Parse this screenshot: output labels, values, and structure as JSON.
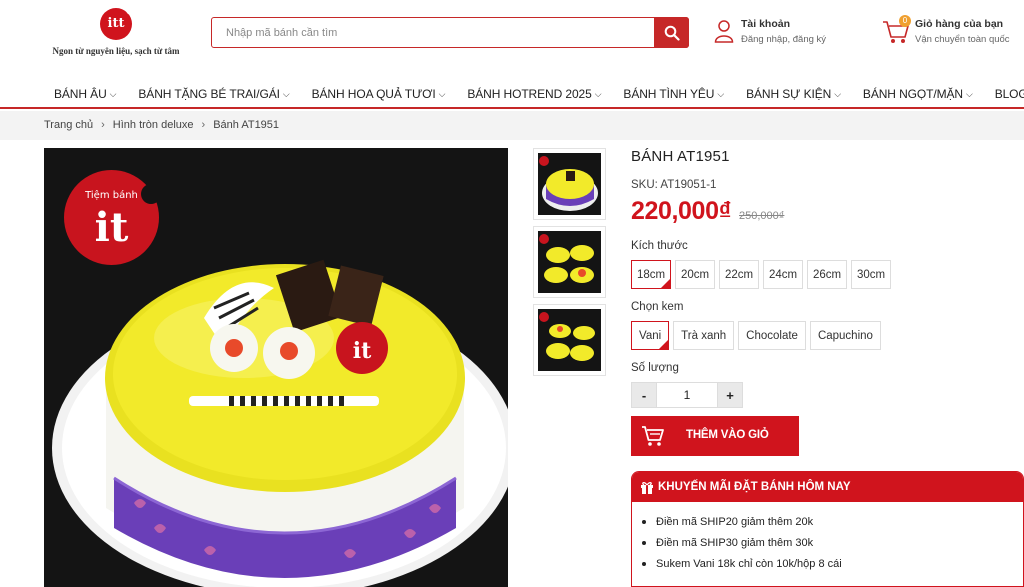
{
  "header": {
    "logo_text": "itt",
    "slogan": "Ngon từ nguyên liệu, sạch từ tâm",
    "search_placeholder": "Nhập mã bánh cần tìm",
    "account_title": "Tài khoản",
    "account_sub": "Đăng nhập, đăng ký",
    "cart_title": "Giỏ hàng của bạn",
    "cart_sub": "Vận chuyển toàn quốc",
    "cart_count": "0"
  },
  "nav": {
    "items": [
      {
        "label": "BÁNH ÂU"
      },
      {
        "label": "BÁNH TẶNG BÉ TRAI/GÁI"
      },
      {
        "label": "BÁNH HOA QUẢ TƯƠI"
      },
      {
        "label": "BÁNH HOTREND 2025"
      },
      {
        "label": "BÁNH TÌNH YÊU"
      },
      {
        "label": "BÁNH SỰ KIỆN"
      },
      {
        "label": "BÁNH NGỌT/MẶN"
      },
      {
        "label": "BLOG"
      }
    ]
  },
  "breadcrumb": [
    "Trang chủ",
    "Hình tròn deluxe",
    "Bánh AT1951"
  ],
  "gallery": {
    "badge_label": "Tiệm bánh",
    "badge_it": "it"
  },
  "product": {
    "title": "BÁNH AT1951",
    "sku": "SKU: AT19051-1",
    "price": "220,000₫",
    "old_price": "250,000₫",
    "size_label": "Kích thước",
    "sizes": [
      "18cm",
      "20cm",
      "22cm",
      "24cm",
      "26cm",
      "30cm"
    ],
    "selected_size": "18cm",
    "cream_label": "Chọn kem",
    "creams": [
      "Vani",
      "Trà xanh",
      "Chocolate",
      "Capuchino"
    ],
    "selected_cream": "Vani",
    "qty_label": "Số lượng",
    "qty_minus": "-",
    "qty_value": "1",
    "qty_plus": "+",
    "add_to_cart": "THÊM VÀO GIỎ"
  },
  "promo": {
    "title": "KHUYẾN MÃI ĐẶT BÁNH HÔM NAY",
    "items": [
      "Điền mã SHIP20 giảm thêm 20k",
      "Điền mã SHIP30 giảm thêm 30k",
      "Sukem Vani 18k chỉ còn 10k/hộp 8 cái"
    ]
  },
  "colors": {
    "brand": "#d0141d",
    "cake_yellow": "#f2ea2a",
    "ribbon": "#6a3fb8"
  }
}
